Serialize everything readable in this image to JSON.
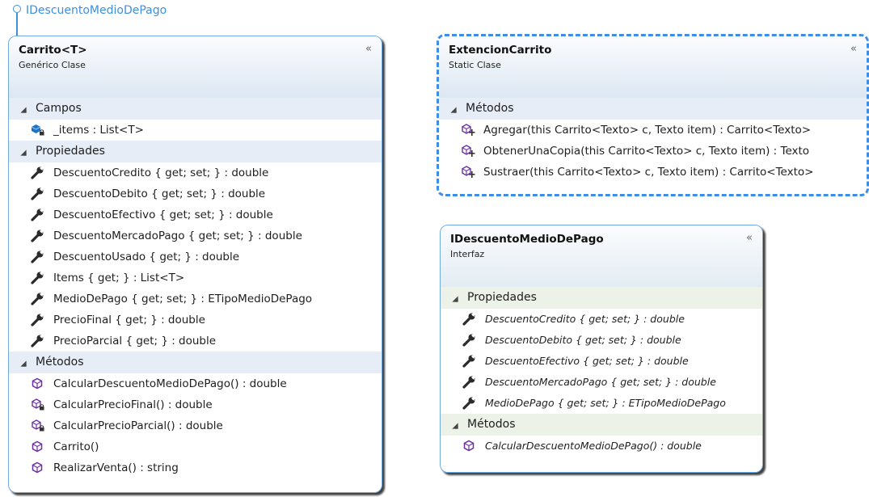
{
  "interface_label": "IDescuentoMedioDePago",
  "collapse_glyph": "«",
  "carrito": {
    "title": "Carrito<T>",
    "stereotype": "Genérico Clase",
    "sections": [
      {
        "name": "Campos",
        "items": [
          {
            "text": "_items : List<T>",
            "icon": "private-field-icon"
          }
        ]
      },
      {
        "name": "Propiedades",
        "items": [
          {
            "text": "DescuentoCredito { get; set; } : double",
            "icon": "property-wrench-icon"
          },
          {
            "text": "DescuentoDebito { get; set; } : double",
            "icon": "property-wrench-icon"
          },
          {
            "text": "DescuentoEfectivo { get; set; } : double",
            "icon": "property-wrench-icon"
          },
          {
            "text": "DescuentoMercadoPago { get; set; } : double",
            "icon": "property-wrench-icon"
          },
          {
            "text": "DescuentoUsado { get; } : double",
            "icon": "property-wrench-icon"
          },
          {
            "text": "Items { get; } : List<T>",
            "icon": "property-wrench-icon"
          },
          {
            "text": "MedioDePago { get; set; } : ETipoMedioDePago",
            "icon": "property-wrench-icon"
          },
          {
            "text": "PrecioFinal { get; } : double",
            "icon": "property-wrench-icon"
          },
          {
            "text": "PrecioParcial { get; } : double",
            "icon": "property-wrench-icon"
          }
        ]
      },
      {
        "name": "Métodos",
        "items": [
          {
            "text": "CalcularDescuentoMedioDePago() : double",
            "icon": "method-icon"
          },
          {
            "text": "CalcularPrecioFinal() : double",
            "icon": "private-method-icon"
          },
          {
            "text": "CalcularPrecioParcial() : double",
            "icon": "private-method-icon"
          },
          {
            "text": "Carrito()",
            "icon": "method-icon"
          },
          {
            "text": "RealizarVenta() : string",
            "icon": "method-icon"
          }
        ]
      }
    ]
  },
  "extension": {
    "title": "ExtencionCarrito",
    "stereotype": "Static Clase",
    "sections": [
      {
        "name": "Métodos",
        "items": [
          {
            "text": "Agregar(this Carrito<Texto> c, Texto item) : Carrito<Texto>",
            "icon": "extension-method-icon"
          },
          {
            "text": "ObtenerUnaCopia(this Carrito<Texto> c, Texto item) : Texto",
            "icon": "extension-method-icon"
          },
          {
            "text": "Sustraer(this Carrito<Texto> c, Texto item) : Carrito<Texto>",
            "icon": "extension-method-icon"
          }
        ]
      }
    ]
  },
  "interface": {
    "title": "IDescuentoMedioDePago",
    "stereotype": "Interfaz",
    "sections": [
      {
        "name": "Propiedades",
        "items": [
          {
            "text": "DescuentoCredito { get; set; } : double",
            "icon": "property-wrench-icon"
          },
          {
            "text": "DescuentoDebito { get; set; } : double",
            "icon": "property-wrench-icon"
          },
          {
            "text": "DescuentoEfectivo { get; set; } : double",
            "icon": "property-wrench-icon"
          },
          {
            "text": "DescuentoMercadoPago { get; set; } : double",
            "icon": "property-wrench-icon"
          },
          {
            "text": "MedioDePago { get; set; } : ETipoMedioDePago",
            "icon": "property-wrench-icon"
          }
        ]
      },
      {
        "name": "Métodos",
        "items": [
          {
            "text": "CalcularDescuentoMedioDePago() : double",
            "icon": "method-icon"
          }
        ]
      }
    ]
  }
}
